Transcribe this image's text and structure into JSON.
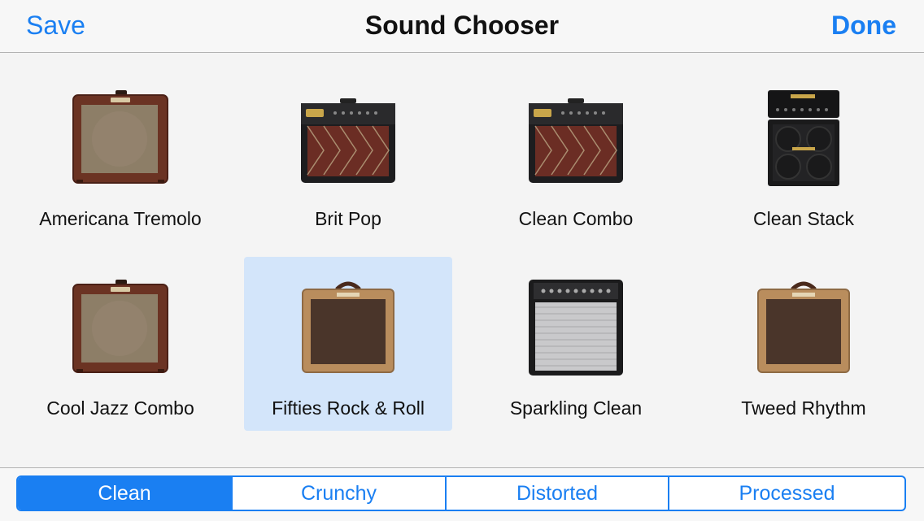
{
  "navbar": {
    "save_label": "Save",
    "title": "Sound Chooser",
    "done_label": "Done"
  },
  "amps": [
    {
      "label": "Americana Tremolo",
      "style": "brown-combo"
    },
    {
      "label": "Brit Pop",
      "style": "black-combo"
    },
    {
      "label": "Clean Combo",
      "style": "black-combo"
    },
    {
      "label": "Clean Stack",
      "style": "stack"
    },
    {
      "label": "Cool Jazz Combo",
      "style": "brown-combo"
    },
    {
      "label": "Fifties Rock & Roll",
      "style": "tweed-combo",
      "selected": true
    },
    {
      "label": "Sparkling Clean",
      "style": "silver-combo"
    },
    {
      "label": "Tweed Rhythm",
      "style": "tweed-combo"
    }
  ],
  "tabs": [
    {
      "label": "Clean",
      "active": true
    },
    {
      "label": "Crunchy"
    },
    {
      "label": "Distorted"
    },
    {
      "label": "Processed"
    }
  ],
  "colors": {
    "accent": "#1a7ff2",
    "selection": "#d3e5fa"
  }
}
